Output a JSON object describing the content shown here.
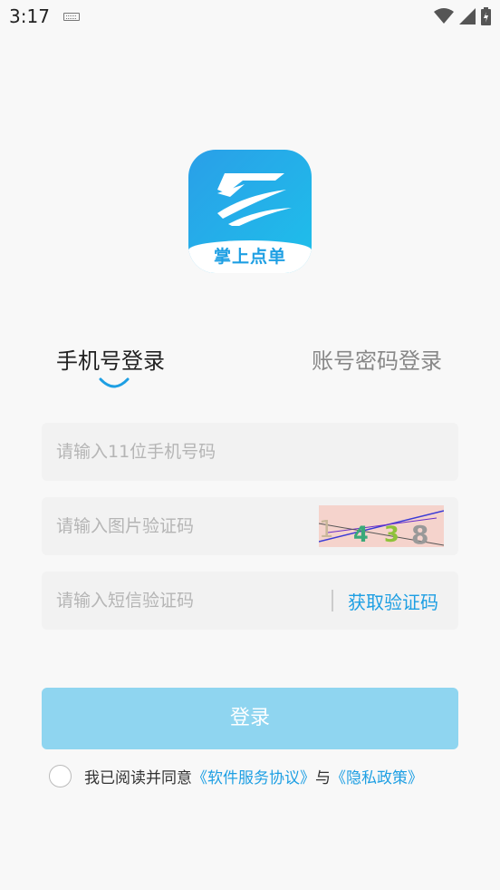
{
  "status": {
    "time": "3:17"
  },
  "logo": {
    "text": "掌上点单"
  },
  "tabs": {
    "phone": "手机号登录",
    "account": "账号密码登录"
  },
  "form": {
    "phone_placeholder": "请输入11位手机号码",
    "captcha_placeholder": "请输入图片验证码",
    "captcha_chars": [
      "1",
      "4",
      "3",
      "8"
    ],
    "sms_placeholder": "请输入短信验证码",
    "get_code": "获取验证码"
  },
  "login": {
    "label": "登录"
  },
  "agreement": {
    "prefix": "我已阅读并同意",
    "terms": "《软件服务协议》",
    "and": "与",
    "privacy": "《隐私政策》"
  },
  "colors": {
    "accent": "#1e9fe3",
    "button": "#8fd5f0",
    "background": "#f8f8f8"
  }
}
